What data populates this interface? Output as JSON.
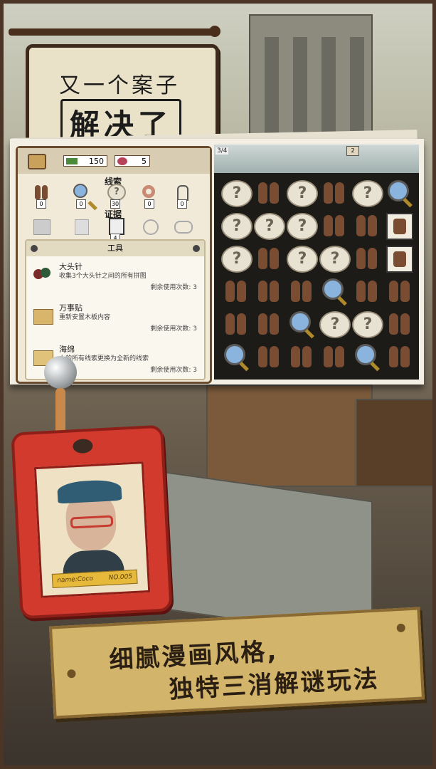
{
  "sign": {
    "line1": "又一个案子",
    "line2": "解决了"
  },
  "topbar": {
    "money": "150",
    "candy": "5"
  },
  "clues": {
    "title": "线索",
    "items": [
      {
        "icon": "footprints-icon",
        "count": "0"
      },
      {
        "icon": "magnifier-icon",
        "count": "0"
      },
      {
        "icon": "question-bubble-icon",
        "count": "30"
      },
      {
        "icon": "donut-icon",
        "count": "0"
      },
      {
        "icon": "clamp-icon",
        "count": "0"
      }
    ]
  },
  "evidence": {
    "title": "证据",
    "items": [
      {
        "icon": "map-icon"
      },
      {
        "icon": "paper-icon"
      },
      {
        "icon": "photo-icon",
        "count": "4"
      },
      {
        "icon": "watch-icon"
      },
      {
        "icon": "chain-icon"
      }
    ]
  },
  "tools": {
    "title": "工具",
    "items": [
      {
        "name": "大头针",
        "desc": "收集3个大头针之间的所有拼图",
        "remain": "剩余使用次数: 3",
        "icon": "pin-icon"
      },
      {
        "name": "万事贴",
        "desc": "重新安置木板内容",
        "remain": "剩余使用次数: 3",
        "icon": "sticky-note-icon"
      },
      {
        "name": "海绵",
        "desc": "上的所有线索更换为全新的线索",
        "remain": "剩余使用次数: 3",
        "icon": "sponge-icon"
      }
    ]
  },
  "board": {
    "progress": "3/4",
    "badge": "2"
  },
  "badge_tag": {
    "name": "name:Coco",
    "number": "NO.005"
  },
  "banner": {
    "line1": "细腻漫画风格,",
    "line2": "独特三消解谜玩法"
  },
  "colors": {
    "tag_red": "#d23a2e",
    "banner_gold": "#d2b56b",
    "frame_brown": "#4b3526"
  }
}
